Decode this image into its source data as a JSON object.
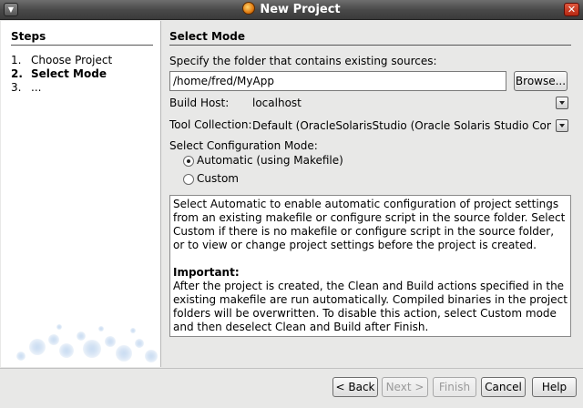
{
  "window": {
    "title": "New Project"
  },
  "steps": {
    "heading": "Steps",
    "items": [
      {
        "num": "1.",
        "label": "Choose Project"
      },
      {
        "num": "2.",
        "label": "Select Mode"
      },
      {
        "num": "3.",
        "label": "..."
      }
    ]
  },
  "main": {
    "section_title": "Select Mode",
    "folder": {
      "label": "Specify the folder that contains existing sources:",
      "value": "/home/fred/MyApp",
      "browse_label": "Browse..."
    },
    "build_host": {
      "label": "Build Host:",
      "value": "localhost"
    },
    "tool_collection": {
      "label": "Tool Collection:",
      "value": "Default (OracleSolarisStudio (Oracle Solaris Studio Com..."
    },
    "config_mode": {
      "label": "Select Configuration Mode:",
      "options": [
        {
          "label": "Automatic (using Makefile)",
          "selected": true
        },
        {
          "label": "Custom",
          "selected": false
        }
      ]
    },
    "description": {
      "para1": "Select Automatic to enable automatic configuration of project settings from an existing makefile or configure script in the source folder. Select Custom if there is no makefile or configure script in the source folder, or to view or change project settings before the project is created.",
      "important_heading": "Important:",
      "para2": "After the project is created, the Clean and Build actions specified in the existing makefile are run automatically. Compiled binaries in the project folders will be overwritten. To disable this action, select Custom mode and then deselect Clean and Build after Finish."
    }
  },
  "buttons": {
    "back": "< Back",
    "next": "Next >",
    "finish": "Finish",
    "cancel": "Cancel",
    "help": "Help"
  }
}
